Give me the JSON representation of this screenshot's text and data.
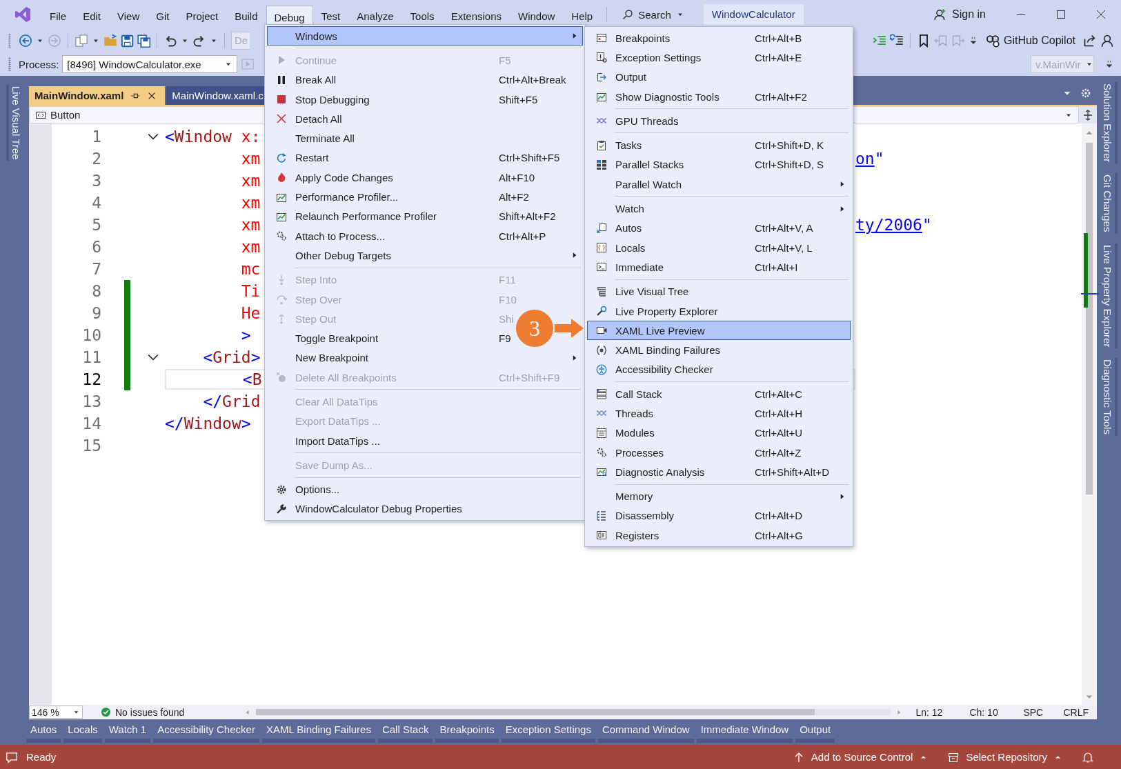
{
  "title_bar": {
    "menu": [
      {
        "label": "File",
        "selected": false
      },
      {
        "label": "Edit",
        "selected": false
      },
      {
        "label": "View",
        "selected": false
      },
      {
        "label": "Git",
        "selected": false
      },
      {
        "label": "Project",
        "selected": false
      },
      {
        "label": "Build",
        "selected": false
      },
      {
        "label": "Debug",
        "selected": true
      },
      {
        "label": "Test",
        "selected": false
      },
      {
        "label": "Analyze",
        "selected": false
      },
      {
        "label": "Tools",
        "selected": false
      },
      {
        "label": "Extensions",
        "selected": false
      },
      {
        "label": "Window",
        "selected": false
      },
      {
        "label": "Help",
        "selected": false
      }
    ],
    "search": "Search",
    "solution": "WindowCalculator",
    "sign_in": "Sign in"
  },
  "toolbar": {
    "config_dropdown": "De",
    "copilot": "GitHub Copilot",
    "process_label": "Process:",
    "process": "[8496] WindowCalculator.exe",
    "location_dropdown": "v.MainWir"
  },
  "left_tool_tabs": [
    "Live Visual Tree"
  ],
  "right_tool_tabs": [
    "Solution Explorer",
    "Git Changes",
    "Live Property Explorer",
    "Diagnostic Tools"
  ],
  "document_tabs": [
    {
      "label": "MainWindow.xaml",
      "selected": true
    },
    {
      "label": "MainWindow.xaml.c",
      "selected": false
    }
  ],
  "nav_bar": {
    "element": "Button"
  },
  "editor": {
    "lines": [
      {
        "number": "1",
        "current": false,
        "changed": false,
        "fold": true,
        "tokens": [
          {
            "text": "<",
            "kind": "punct"
          },
          {
            "text": "Window",
            "kind": "tag"
          },
          {
            "text": " x:",
            "kind": "attr"
          }
        ]
      },
      {
        "number": "2",
        "current": false,
        "changed": false,
        "fold": false,
        "tokens": [
          {
            "text": "        xm",
            "kind": "attr"
          }
        ],
        "tail": [
          {
            "text": "on",
            "kind": "link"
          },
          {
            "text": "\"",
            "kind": "punct"
          }
        ]
      },
      {
        "number": "3",
        "current": false,
        "changed": false,
        "fold": false,
        "tokens": [
          {
            "text": "        xm",
            "kind": "attr"
          }
        ]
      },
      {
        "number": "4",
        "current": false,
        "changed": false,
        "fold": false,
        "tokens": [
          {
            "text": "        xm",
            "kind": "attr"
          }
        ]
      },
      {
        "number": "5",
        "current": false,
        "changed": false,
        "fold": false,
        "tokens": [
          {
            "text": "        xm",
            "kind": "attr"
          }
        ],
        "tail": [
          {
            "text": "ty/2006",
            "kind": "link"
          },
          {
            "text": "\"",
            "kind": "punct"
          }
        ]
      },
      {
        "number": "6",
        "current": false,
        "changed": false,
        "fold": false,
        "tokens": [
          {
            "text": "        xm",
            "kind": "attr"
          }
        ]
      },
      {
        "number": "7",
        "current": false,
        "changed": false,
        "fold": false,
        "tokens": [
          {
            "text": "        mc",
            "kind": "attr"
          }
        ]
      },
      {
        "number": "8",
        "current": false,
        "changed": true,
        "fold": false,
        "tokens": [
          {
            "text": "        Ti",
            "kind": "attr"
          }
        ]
      },
      {
        "number": "9",
        "current": false,
        "changed": true,
        "fold": false,
        "tokens": [
          {
            "text": "        He",
            "kind": "attr"
          }
        ]
      },
      {
        "number": "10",
        "current": false,
        "changed": true,
        "fold": false,
        "tokens": [
          {
            "text": "        >",
            "kind": "punct"
          }
        ]
      },
      {
        "number": "11",
        "current": false,
        "changed": true,
        "fold": true,
        "tokens": [
          {
            "text": "    <",
            "kind": "punct"
          },
          {
            "text": "Grid",
            "kind": "tag"
          },
          {
            "text": ">",
            "kind": "punct"
          }
        ]
      },
      {
        "number": "12",
        "current": true,
        "changed": true,
        "fold": false,
        "tokens": [
          {
            "text": "        <",
            "kind": "punct"
          },
          {
            "text": "B",
            "kind": "tag"
          }
        ]
      },
      {
        "number": "13",
        "current": false,
        "changed": false,
        "fold": false,
        "tokens": [
          {
            "text": "    </",
            "kind": "punct"
          },
          {
            "text": "Grid",
            "kind": "tag"
          }
        ]
      },
      {
        "number": "14",
        "current": false,
        "changed": false,
        "fold": false,
        "tokens": [
          {
            "text": "</",
            "kind": "punct"
          },
          {
            "text": "Window",
            "kind": "tag"
          },
          {
            "text": ">",
            "kind": "punct"
          }
        ]
      },
      {
        "number": "15",
        "current": false,
        "changed": false,
        "fold": false
      }
    ]
  },
  "editor_status": {
    "zoom": "146 %",
    "issues": "No issues found",
    "line": "Ln: 12",
    "column": "Ch: 10",
    "whitespace": "SPC",
    "line_endings": "CRLF"
  },
  "tool_tabs": [
    "Autos",
    "Locals",
    "Watch 1",
    "Accessibility Checker",
    "XAML Binding Failures",
    "Call Stack",
    "Breakpoints",
    "Exception Settings",
    "Command Window",
    "Immediate Window",
    "Output"
  ],
  "status_bar": {
    "state": "Ready",
    "source_control": "Add to Source Control",
    "repository": "Select Repository"
  },
  "debug_menu": {
    "groups": [
      [
        {
          "label": "Windows",
          "disabled": false,
          "submenu": true,
          "selected": true
        }
      ],
      [
        {
          "label": "Continue",
          "shortcut": "F5",
          "disabled": true,
          "submenu": false,
          "selected": false
        },
        {
          "label": "Break All",
          "shortcut": "Ctrl+Alt+Break",
          "disabled": false,
          "submenu": false,
          "selected": false
        },
        {
          "label": "Stop Debugging",
          "shortcut": "Shift+F5",
          "disabled": false,
          "submenu": false,
          "selected": false
        },
        {
          "label": "Detach All",
          "disabled": false,
          "submenu": false,
          "selected": false
        },
        {
          "label": "Terminate All",
          "disabled": false,
          "submenu": false,
          "selected": false
        },
        {
          "label": "Restart",
          "shortcut": "Ctrl+Shift+F5",
          "disabled": false,
          "submenu": false,
          "selected": false
        },
        {
          "label": "Apply Code Changes",
          "shortcut": "Alt+F10",
          "disabled": false,
          "submenu": false,
          "selected": false
        },
        {
          "label": "Performance Profiler...",
          "shortcut": "Alt+F2",
          "disabled": false,
          "submenu": false,
          "selected": false
        },
        {
          "label": "Relaunch Performance Profiler",
          "shortcut": "Shift+Alt+F2",
          "disabled": false,
          "submenu": false,
          "selected": false
        },
        {
          "label": "Attach to Process...",
          "shortcut": "Ctrl+Alt+P",
          "disabled": false,
          "submenu": false,
          "selected": false
        },
        {
          "label": "Other Debug Targets",
          "disabled": false,
          "submenu": true,
          "selected": false
        }
      ],
      [
        {
          "label": "Step Into",
          "shortcut": "F11",
          "disabled": true,
          "submenu": false,
          "selected": false
        },
        {
          "label": "Step Over",
          "shortcut": "F10",
          "disabled": true,
          "submenu": false,
          "selected": false
        },
        {
          "label": "Step Out",
          "shortcut": "Shi",
          "disabled": true,
          "submenu": false,
          "selected": false
        },
        {
          "label": "Toggle Breakpoint",
          "shortcut": "F9",
          "disabled": false,
          "submenu": false,
          "selected": false
        },
        {
          "label": "New Breakpoint",
          "disabled": false,
          "submenu": true,
          "selected": false
        },
        {
          "label": "Delete All Breakpoints",
          "shortcut": "Ctrl+Shift+F9",
          "disabled": true,
          "submenu": false,
          "selected": false
        }
      ],
      [
        {
          "label": "Clear All DataTips",
          "disabled": true,
          "submenu": false,
          "selected": false
        },
        {
          "label": "Export DataTips ...",
          "disabled": true,
          "submenu": false,
          "selected": false
        },
        {
          "label": "Import DataTips ...",
          "disabled": false,
          "submenu": false,
          "selected": false
        }
      ],
      [
        {
          "label": "Save Dump As...",
          "disabled": true,
          "submenu": false,
          "selected": false
        }
      ],
      [
        {
          "label": "Options...",
          "disabled": false,
          "submenu": false,
          "selected": false
        },
        {
          "label": "WindowCalculator Debug Properties",
          "disabled": false,
          "submenu": false,
          "selected": false
        }
      ]
    ]
  },
  "windows_submenu": {
    "groups": [
      [
        {
          "label": "Breakpoints",
          "shortcut": "Ctrl+Alt+B",
          "disabled": false,
          "submenu": false,
          "selected": false
        },
        {
          "label": "Exception Settings",
          "shortcut": "Ctrl+Alt+E",
          "disabled": false,
          "submenu": false,
          "selected": false
        },
        {
          "label": "Output",
          "disabled": false,
          "submenu": false,
          "selected": false
        },
        {
          "label": "Show Diagnostic Tools",
          "shortcut": "Ctrl+Alt+F2",
          "disabled": false,
          "submenu": false,
          "selected": false
        }
      ],
      [
        {
          "label": "GPU Threads",
          "disabled": false,
          "submenu": false,
          "selected": false
        }
      ],
      [
        {
          "label": "Tasks",
          "shortcut": "Ctrl+Shift+D, K",
          "disabled": false,
          "submenu": false,
          "selected": false
        },
        {
          "label": "Parallel Stacks",
          "shortcut": "Ctrl+Shift+D, S",
          "disabled": false,
          "submenu": false,
          "selected": false
        },
        {
          "label": "Parallel Watch",
          "disabled": false,
          "submenu": true,
          "selected": false
        }
      ],
      [
        {
          "label": "Watch",
          "disabled": false,
          "submenu": true,
          "selected": false
        },
        {
          "label": "Autos",
          "shortcut": "Ctrl+Alt+V, A",
          "disabled": false,
          "submenu": false,
          "selected": false
        },
        {
          "label": "Locals",
          "shortcut": "Ctrl+Alt+V, L",
          "disabled": false,
          "submenu": false,
          "selected": false
        },
        {
          "label": "Immediate",
          "shortcut": "Ctrl+Alt+I",
          "disabled": false,
          "submenu": false,
          "selected": false
        }
      ],
      [
        {
          "label": "Live Visual Tree",
          "disabled": false,
          "submenu": false,
          "selected": false
        },
        {
          "label": "Live Property Explorer",
          "disabled": false,
          "submenu": false,
          "selected": false
        },
        {
          "label": "XAML Live Preview",
          "disabled": false,
          "submenu": false,
          "selected": true
        },
        {
          "label": "XAML Binding Failures",
          "disabled": false,
          "submenu": false,
          "selected": false
        },
        {
          "label": "Accessibility Checker",
          "disabled": false,
          "submenu": false,
          "selected": false
        }
      ],
      [
        {
          "label": "Call Stack",
          "shortcut": "Ctrl+Alt+C",
          "disabled": false,
          "submenu": false,
          "selected": false
        },
        {
          "label": "Threads",
          "shortcut": "Ctrl+Alt+H",
          "disabled": false,
          "submenu": false,
          "selected": false
        },
        {
          "label": "Modules",
          "shortcut": "Ctrl+Alt+U",
          "disabled": false,
          "submenu": false,
          "selected": false
        },
        {
          "label": "Processes",
          "shortcut": "Ctrl+Alt+Z",
          "disabled": false,
          "submenu": false,
          "selected": false
        },
        {
          "label": "Diagnostic Analysis",
          "shortcut": "Ctrl+Shift+Alt+D",
          "disabled": false,
          "submenu": false,
          "selected": false
        }
      ],
      [
        {
          "label": "Memory",
          "disabled": false,
          "submenu": true,
          "selected": false
        },
        {
          "label": "Disassembly",
          "shortcut": "Ctrl+Alt+D",
          "disabled": false,
          "submenu": false,
          "selected": false
        },
        {
          "label": "Registers",
          "shortcut": "Ctrl+Alt+G",
          "disabled": false,
          "submenu": false,
          "selected": false
        }
      ]
    ]
  },
  "callout": {
    "number": "3"
  }
}
